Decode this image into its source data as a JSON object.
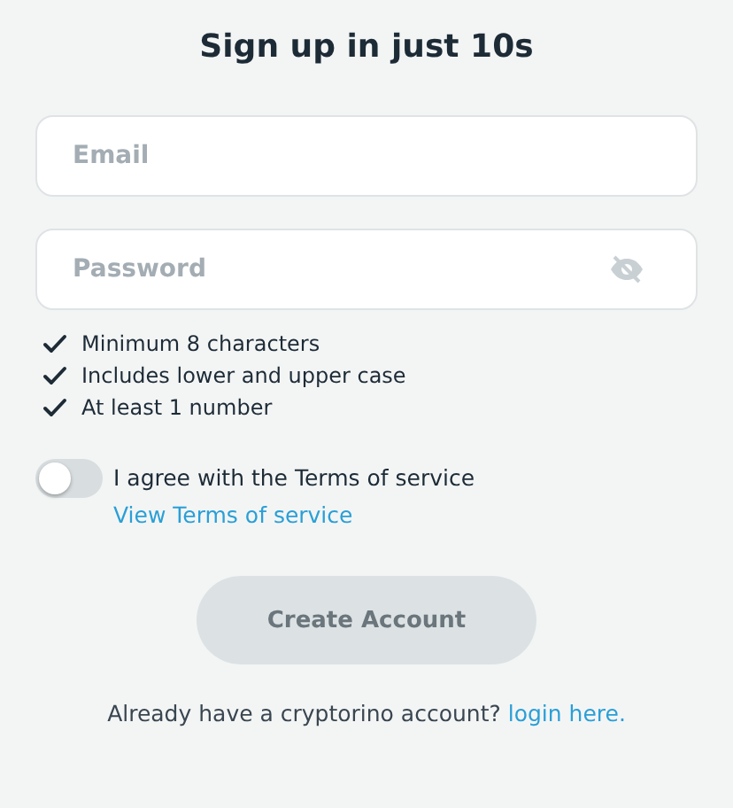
{
  "title": "Sign up in just 10s",
  "fields": [
    {
      "kind": "email",
      "placeholder": "Email"
    },
    {
      "kind": "password",
      "placeholder": "Password"
    }
  ],
  "requirements": [
    {
      "text": "Minimum 8 characters",
      "met": true
    },
    {
      "text": "Includes lower and upper case",
      "met": true
    },
    {
      "text": "At least 1 number",
      "met": true
    }
  ],
  "terms": {
    "on": false,
    "text": "I agree with the Terms of service",
    "link": "View Terms of service"
  },
  "submit": {
    "label": "Create Account",
    "disabled": true
  },
  "footer": {
    "text": "Already have a cryptorino account?",
    "link": "login here."
  }
}
